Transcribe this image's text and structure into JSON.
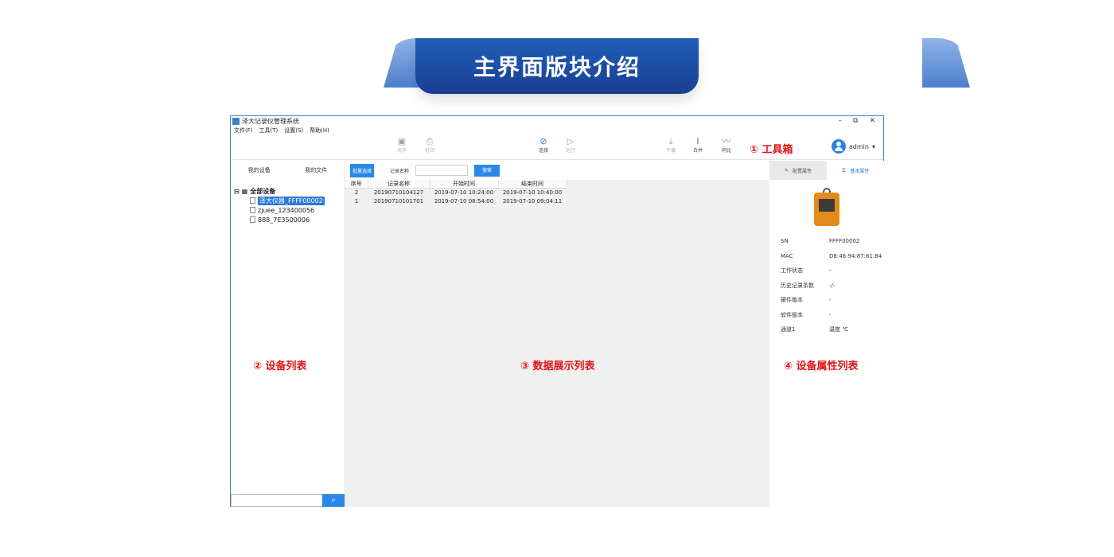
{
  "banner": {
    "title": "主界面版块介绍"
  },
  "window": {
    "title": "泽大记录仪管理系统",
    "controls": [
      "–",
      "⧉",
      "✕"
    ]
  },
  "menu": {
    "items": [
      "文件(F)",
      "工具(T)",
      "设置(S)",
      "帮助(H)"
    ]
  },
  "toolbar": {
    "save": "另存",
    "print": "打印",
    "connect": "连接",
    "run": "运行",
    "download": "下载",
    "merge": "合并",
    "compare": "同比",
    "annotation": "① 工具箱",
    "user": "admin"
  },
  "left": {
    "tab_devices": "我的设备",
    "tab_files": "我的文件",
    "root": "全部设备",
    "devices": [
      "泽大仪器_FFFF00002",
      "zjuee_123400056",
      "888_7E3500006"
    ],
    "annotation": "② 设备列表"
  },
  "center": {
    "batch_button": "批量选择",
    "record_name_label": "记录名称",
    "search_button": "搜索",
    "columns": [
      "序号",
      "记录名称",
      "开始时间",
      "结束时间"
    ],
    "rows": [
      [
        "2",
        "20190710104127",
        "2019-07-10 10:24:00",
        "2019-07-10 10:40:00"
      ],
      [
        "1",
        "20190710101701",
        "2019-07-10 08:54:00",
        "2019-07-10 09:04:11"
      ]
    ],
    "annotation": "③ 数据展示列表"
  },
  "right": {
    "tab_config": "配置属性",
    "tab_basic": "基本属性",
    "props": [
      {
        "k": "SN",
        "v": "FFFF00002"
      },
      {
        "k": "MAC",
        "v": "D8:46:94:87:61:84"
      },
      {
        "k": "工作状态",
        "v": "-"
      },
      {
        "k": "历史记录条数",
        "v": "-/-"
      },
      {
        "k": "硬件版本",
        "v": "-"
      },
      {
        "k": "软件版本",
        "v": "-"
      },
      {
        "k": "通道1",
        "v": "温度  ℃"
      }
    ],
    "annotation": "④ 设备属性列表"
  },
  "colors": {
    "accent": "#2b88e8",
    "annotation": "#e31414",
    "banner": "#1f5fb8"
  }
}
